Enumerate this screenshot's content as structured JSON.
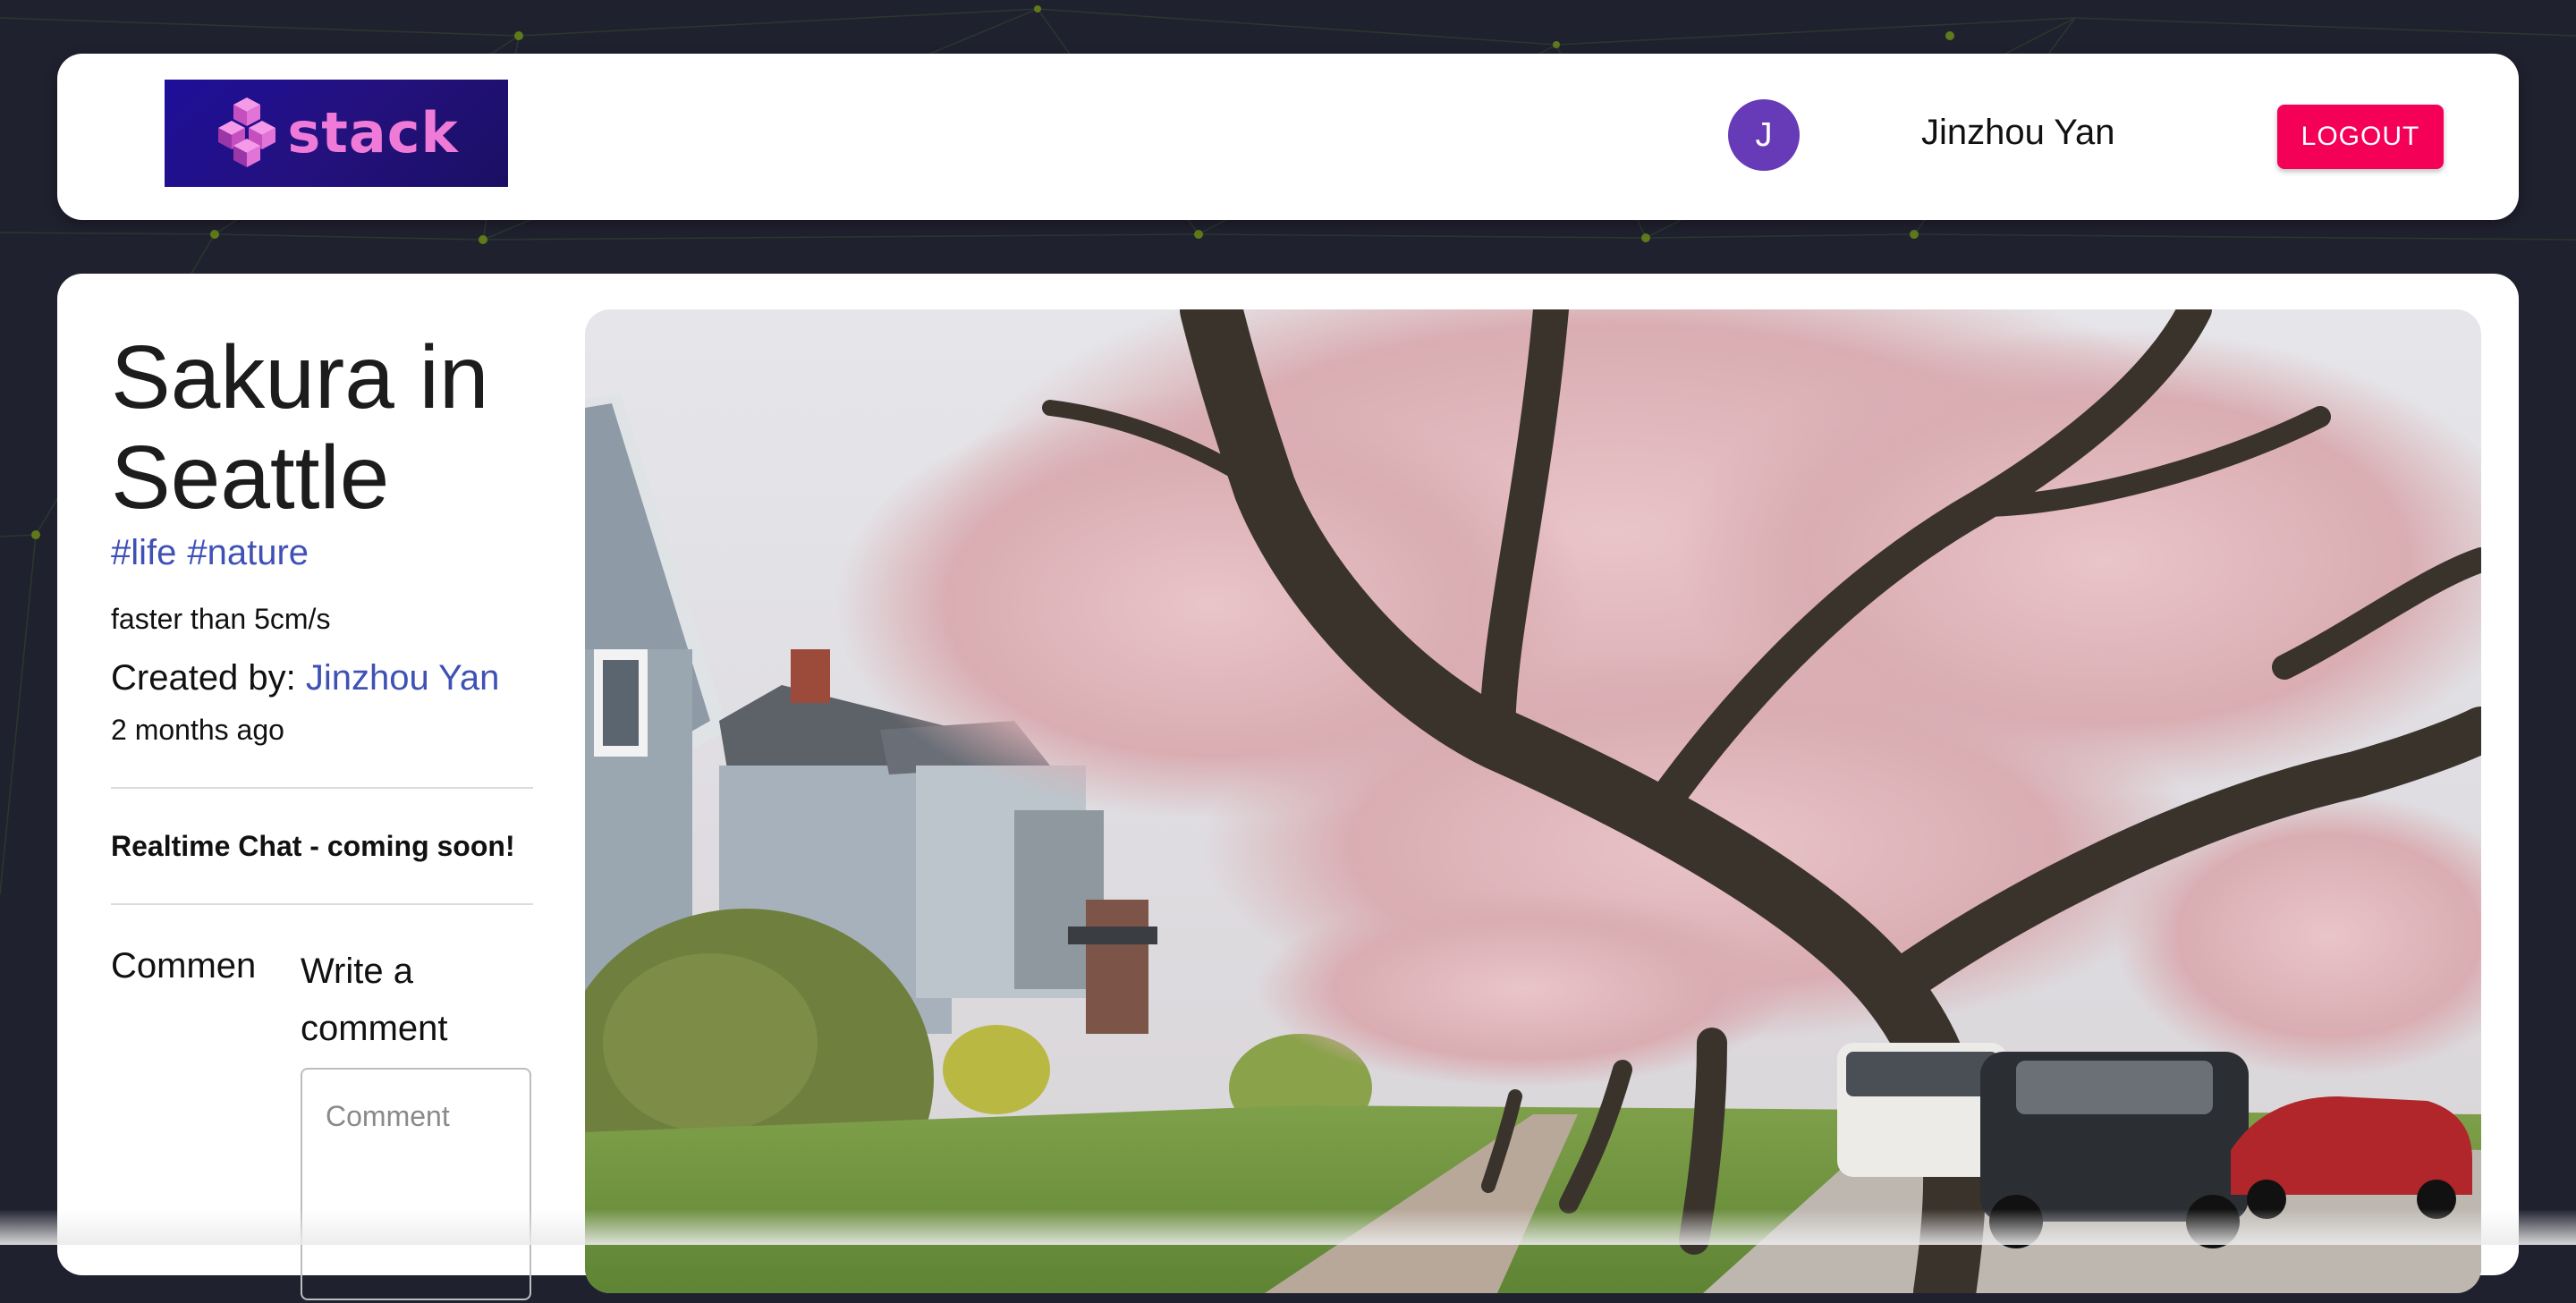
{
  "header": {
    "logo_text": "stack",
    "avatar_initial": "J",
    "user_name": "Jinzhou Yan",
    "logout_label": "LOGOUT"
  },
  "post": {
    "title": "Sakura in Seattle",
    "tags": [
      "#life",
      "#nature"
    ],
    "message": "faster than 5cm/s",
    "created_by_label": "Created by:",
    "author": "Jinzhou Yan",
    "time_ago": "2 months ago",
    "chat_notice": "Realtime Chat - coming soon!",
    "comments_heading": "Comments",
    "write_comment_heading": "Write a comment",
    "comment_placeholder": "Comment",
    "image_icon": "cherry-blossom-street-photo"
  },
  "colors": {
    "page_background": "#20212f",
    "accent_blue": "#3f51b5",
    "avatar_purple": "#673ab7",
    "logout_pink": "#f50057",
    "logo_background": "#1e0f9a",
    "logo_text": "#f07ad8"
  }
}
